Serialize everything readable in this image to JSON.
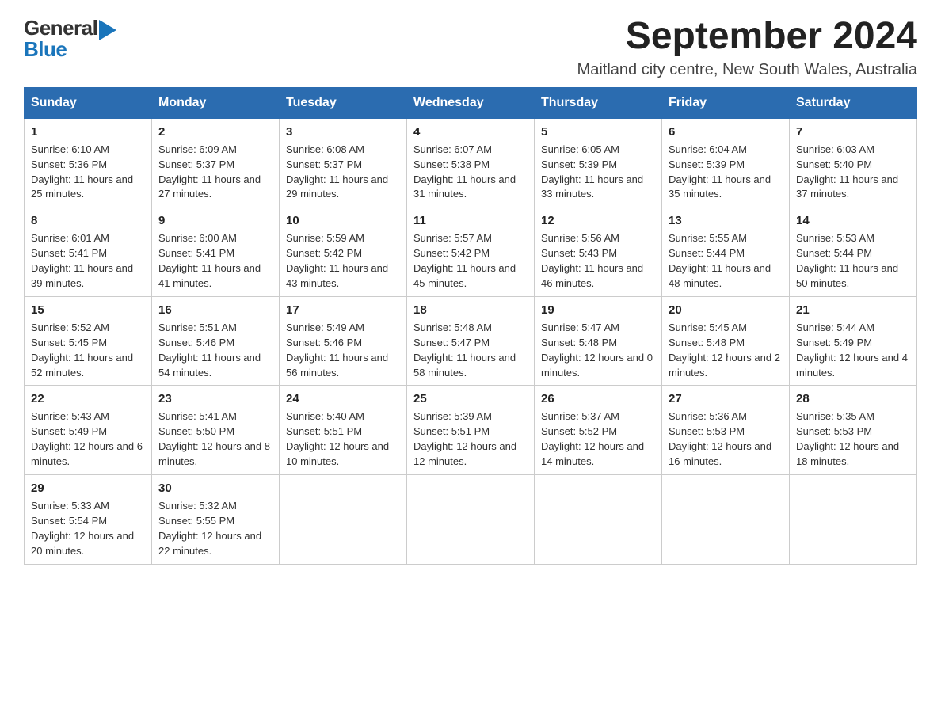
{
  "header": {
    "logo_general": "General",
    "logo_blue": "Blue",
    "month_title": "September 2024",
    "location": "Maitland city centre, New South Wales, Australia"
  },
  "weekdays": [
    "Sunday",
    "Monday",
    "Tuesday",
    "Wednesday",
    "Thursday",
    "Friday",
    "Saturday"
  ],
  "weeks": [
    [
      {
        "day": "1",
        "sunrise": "Sunrise: 6:10 AM",
        "sunset": "Sunset: 5:36 PM",
        "daylight": "Daylight: 11 hours and 25 minutes."
      },
      {
        "day": "2",
        "sunrise": "Sunrise: 6:09 AM",
        "sunset": "Sunset: 5:37 PM",
        "daylight": "Daylight: 11 hours and 27 minutes."
      },
      {
        "day": "3",
        "sunrise": "Sunrise: 6:08 AM",
        "sunset": "Sunset: 5:37 PM",
        "daylight": "Daylight: 11 hours and 29 minutes."
      },
      {
        "day": "4",
        "sunrise": "Sunrise: 6:07 AM",
        "sunset": "Sunset: 5:38 PM",
        "daylight": "Daylight: 11 hours and 31 minutes."
      },
      {
        "day": "5",
        "sunrise": "Sunrise: 6:05 AM",
        "sunset": "Sunset: 5:39 PM",
        "daylight": "Daylight: 11 hours and 33 minutes."
      },
      {
        "day": "6",
        "sunrise": "Sunrise: 6:04 AM",
        "sunset": "Sunset: 5:39 PM",
        "daylight": "Daylight: 11 hours and 35 minutes."
      },
      {
        "day": "7",
        "sunrise": "Sunrise: 6:03 AM",
        "sunset": "Sunset: 5:40 PM",
        "daylight": "Daylight: 11 hours and 37 minutes."
      }
    ],
    [
      {
        "day": "8",
        "sunrise": "Sunrise: 6:01 AM",
        "sunset": "Sunset: 5:41 PM",
        "daylight": "Daylight: 11 hours and 39 minutes."
      },
      {
        "day": "9",
        "sunrise": "Sunrise: 6:00 AM",
        "sunset": "Sunset: 5:41 PM",
        "daylight": "Daylight: 11 hours and 41 minutes."
      },
      {
        "day": "10",
        "sunrise": "Sunrise: 5:59 AM",
        "sunset": "Sunset: 5:42 PM",
        "daylight": "Daylight: 11 hours and 43 minutes."
      },
      {
        "day": "11",
        "sunrise": "Sunrise: 5:57 AM",
        "sunset": "Sunset: 5:42 PM",
        "daylight": "Daylight: 11 hours and 45 minutes."
      },
      {
        "day": "12",
        "sunrise": "Sunrise: 5:56 AM",
        "sunset": "Sunset: 5:43 PM",
        "daylight": "Daylight: 11 hours and 46 minutes."
      },
      {
        "day": "13",
        "sunrise": "Sunrise: 5:55 AM",
        "sunset": "Sunset: 5:44 PM",
        "daylight": "Daylight: 11 hours and 48 minutes."
      },
      {
        "day": "14",
        "sunrise": "Sunrise: 5:53 AM",
        "sunset": "Sunset: 5:44 PM",
        "daylight": "Daylight: 11 hours and 50 minutes."
      }
    ],
    [
      {
        "day": "15",
        "sunrise": "Sunrise: 5:52 AM",
        "sunset": "Sunset: 5:45 PM",
        "daylight": "Daylight: 11 hours and 52 minutes."
      },
      {
        "day": "16",
        "sunrise": "Sunrise: 5:51 AM",
        "sunset": "Sunset: 5:46 PM",
        "daylight": "Daylight: 11 hours and 54 minutes."
      },
      {
        "day": "17",
        "sunrise": "Sunrise: 5:49 AM",
        "sunset": "Sunset: 5:46 PM",
        "daylight": "Daylight: 11 hours and 56 minutes."
      },
      {
        "day": "18",
        "sunrise": "Sunrise: 5:48 AM",
        "sunset": "Sunset: 5:47 PM",
        "daylight": "Daylight: 11 hours and 58 minutes."
      },
      {
        "day": "19",
        "sunrise": "Sunrise: 5:47 AM",
        "sunset": "Sunset: 5:48 PM",
        "daylight": "Daylight: 12 hours and 0 minutes."
      },
      {
        "day": "20",
        "sunrise": "Sunrise: 5:45 AM",
        "sunset": "Sunset: 5:48 PM",
        "daylight": "Daylight: 12 hours and 2 minutes."
      },
      {
        "day": "21",
        "sunrise": "Sunrise: 5:44 AM",
        "sunset": "Sunset: 5:49 PM",
        "daylight": "Daylight: 12 hours and 4 minutes."
      }
    ],
    [
      {
        "day": "22",
        "sunrise": "Sunrise: 5:43 AM",
        "sunset": "Sunset: 5:49 PM",
        "daylight": "Daylight: 12 hours and 6 minutes."
      },
      {
        "day": "23",
        "sunrise": "Sunrise: 5:41 AM",
        "sunset": "Sunset: 5:50 PM",
        "daylight": "Daylight: 12 hours and 8 minutes."
      },
      {
        "day": "24",
        "sunrise": "Sunrise: 5:40 AM",
        "sunset": "Sunset: 5:51 PM",
        "daylight": "Daylight: 12 hours and 10 minutes."
      },
      {
        "day": "25",
        "sunrise": "Sunrise: 5:39 AM",
        "sunset": "Sunset: 5:51 PM",
        "daylight": "Daylight: 12 hours and 12 minutes."
      },
      {
        "day": "26",
        "sunrise": "Sunrise: 5:37 AM",
        "sunset": "Sunset: 5:52 PM",
        "daylight": "Daylight: 12 hours and 14 minutes."
      },
      {
        "day": "27",
        "sunrise": "Sunrise: 5:36 AM",
        "sunset": "Sunset: 5:53 PM",
        "daylight": "Daylight: 12 hours and 16 minutes."
      },
      {
        "day": "28",
        "sunrise": "Sunrise: 5:35 AM",
        "sunset": "Sunset: 5:53 PM",
        "daylight": "Daylight: 12 hours and 18 minutes."
      }
    ],
    [
      {
        "day": "29",
        "sunrise": "Sunrise: 5:33 AM",
        "sunset": "Sunset: 5:54 PM",
        "daylight": "Daylight: 12 hours and 20 minutes."
      },
      {
        "day": "30",
        "sunrise": "Sunrise: 5:32 AM",
        "sunset": "Sunset: 5:55 PM",
        "daylight": "Daylight: 12 hours and 22 minutes."
      },
      null,
      null,
      null,
      null,
      null
    ]
  ]
}
